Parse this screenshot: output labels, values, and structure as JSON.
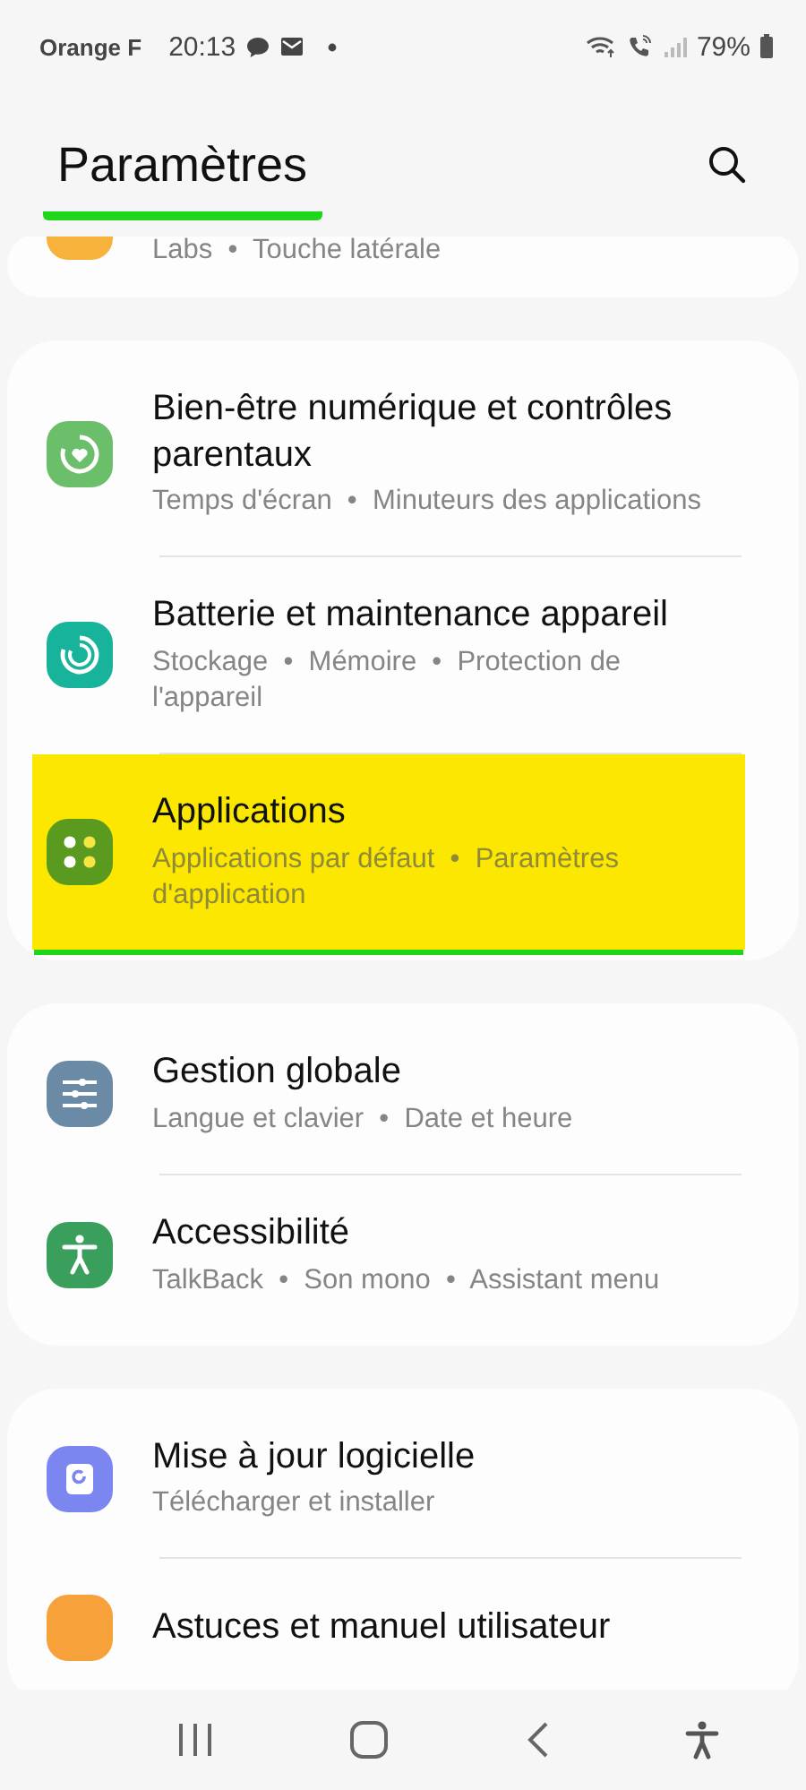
{
  "status_bar": {
    "carrier": "Orange F",
    "time": "20:13",
    "battery": "79%"
  },
  "header": {
    "title": "Paramètres",
    "underlined": true
  },
  "groups": [
    {
      "items": [
        {
          "kind": "labs",
          "subtitle": "Labs  •  Touche latérale",
          "highlighted": false
        }
      ]
    },
    {
      "items": [
        {
          "kind": "wellbeing",
          "title": "Bien-être numérique et contrôles parentaux",
          "subtitle": "Temps d'écran  •  Minuteurs des applications",
          "highlighted": false
        },
        {
          "kind": "battery",
          "title": "Batterie et maintenance appareil",
          "subtitle": "Stockage  •  Mémoire  •  Protection de l'appareil",
          "highlighted": false
        },
        {
          "kind": "apps",
          "title": "Applications",
          "subtitle": "Applications par défaut  •  Paramètres d'application",
          "highlighted": true
        }
      ]
    },
    {
      "items": [
        {
          "kind": "general",
          "title": "Gestion globale",
          "subtitle": "Langue et clavier  •  Date et heure",
          "highlighted": false
        },
        {
          "kind": "accessibility",
          "title": "Accessibilité",
          "subtitle": "TalkBack  •  Son mono  •  Assistant menu",
          "highlighted": false
        }
      ]
    },
    {
      "items": [
        {
          "kind": "update",
          "title": "Mise à jour logicielle",
          "subtitle": "Télécharger et installer",
          "highlighted": false
        },
        {
          "kind": "tips",
          "title": "Astuces et manuel utilisateur",
          "highlighted": false
        }
      ]
    }
  ]
}
